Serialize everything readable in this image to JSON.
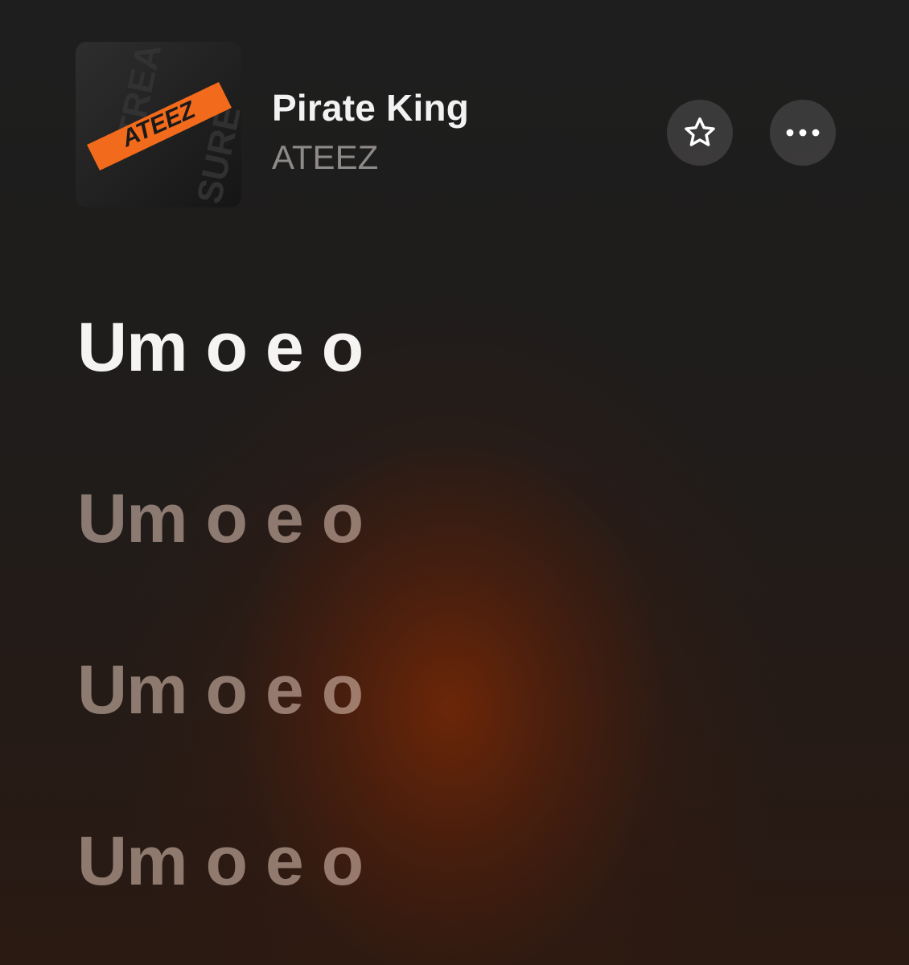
{
  "now_playing": {
    "title": "Pirate King",
    "artist": "ATEEZ",
    "artwork": {
      "band_text": "ATEEZ",
      "side_text_top": "TREA",
      "side_text_bottom": "SURE",
      "accent_color": "#f26a1b"
    }
  },
  "actions": {
    "favorite_icon": "star-outline-icon",
    "more_icon": "ellipsis-icon"
  },
  "lyrics": {
    "lines": [
      {
        "text": "Um o e o",
        "state": "active"
      },
      {
        "text": "Um o e o",
        "state": "upcoming"
      },
      {
        "text": "Um o e o",
        "state": "upcoming"
      },
      {
        "text": "Um o e o",
        "state": "upcoming"
      }
    ]
  },
  "colors": {
    "background": "#1f1c1b",
    "glow": "#6a2307",
    "active_lyric": "#f6f4f2",
    "dim_lyric": "#e4c8ba"
  }
}
